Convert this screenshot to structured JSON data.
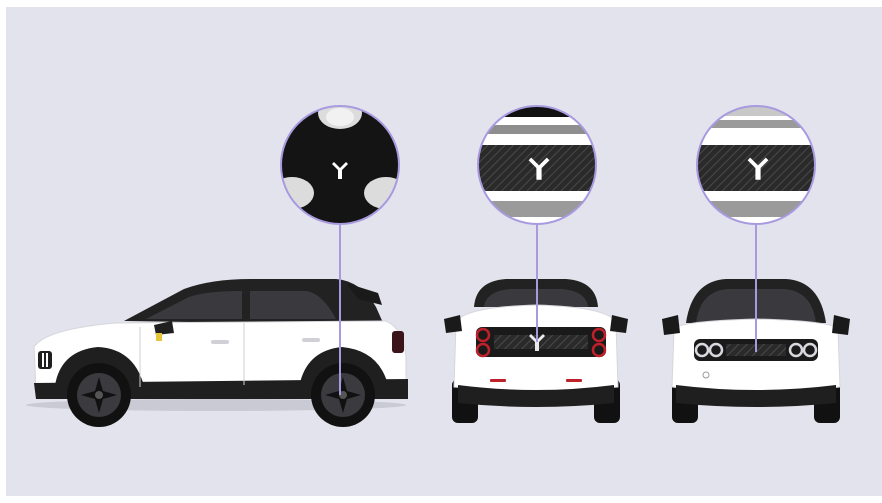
{
  "scene": {
    "views": [
      {
        "name": "side-view",
        "callout": "wheel-hub-logo"
      },
      {
        "name": "rear-view",
        "callout": "rear-panel-logo"
      },
      {
        "name": "front-view",
        "callout": "front-panel-logo"
      }
    ]
  },
  "colors": {
    "background": "#e2e3ec",
    "callout_ring": "#a99ae0",
    "body": "#ffffff",
    "roof": "#222222",
    "tire": "#111111",
    "rear_light": "#c0202a"
  },
  "icons": [
    "brand-logo-icon"
  ]
}
